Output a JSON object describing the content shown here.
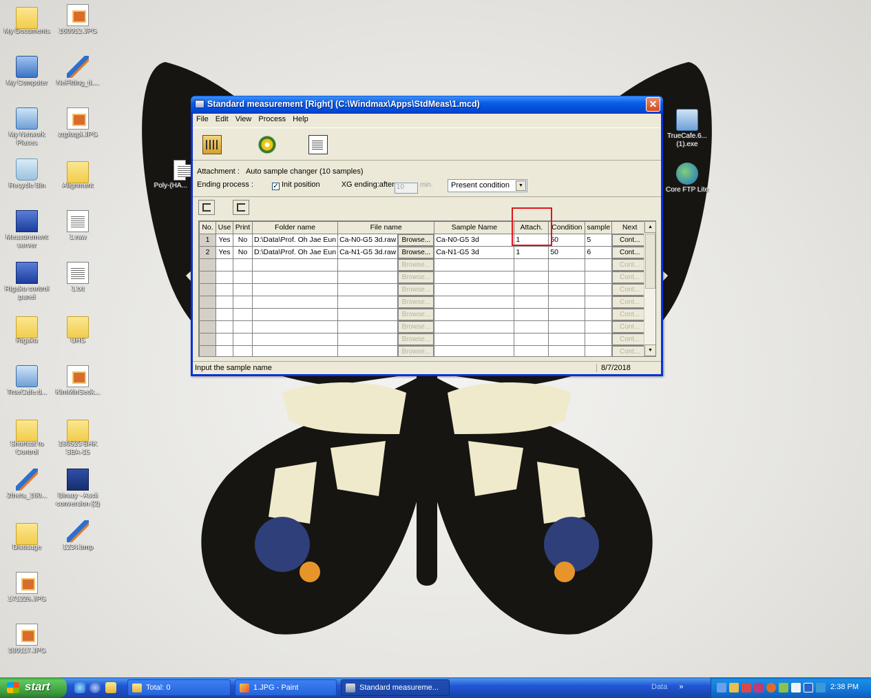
{
  "desktop": {
    "icons_left": [
      {
        "label": "My Documents",
        "icon": "folder-docs-icon"
      },
      {
        "label": "My Computer",
        "icon": "computer-icon"
      },
      {
        "label": "My Network Places",
        "icon": "network-icon"
      },
      {
        "label": "Recycle Bin",
        "icon": "recycle-bin-icon"
      },
      {
        "label": "Measurement server",
        "icon": "server-icon"
      },
      {
        "label": "Rigaku control panel",
        "icon": "control-panel-icon"
      },
      {
        "label": "Rigaku",
        "icon": "folder-icon"
      },
      {
        "label": "TrueCafe.d...",
        "icon": "network-icon"
      },
      {
        "label": "Shortcut to Control",
        "icon": "folder-icon"
      },
      {
        "label": "2theta_160...",
        "icon": "pen-icon"
      },
      {
        "label": "Disusage",
        "icon": "folder-icon"
      },
      {
        "label": "171226.JPG",
        "icon": "image-file-icon"
      },
      {
        "label": "180117.JPG",
        "icon": "image-file-icon"
      }
    ],
    "icons_right_col": [
      {
        "label": "160912.JPG",
        "icon": "image-file-icon"
      },
      {
        "label": "NeFitting_d....",
        "icon": "pen-icon"
      },
      {
        "label": "zqpbqpl.JPG",
        "icon": "image-file-icon"
      },
      {
        "label": "Alignment",
        "icon": "folder-icon"
      },
      {
        "label": "1.raw",
        "icon": "document-icon"
      },
      {
        "label": "1.txt",
        "icon": "text-file-icon"
      },
      {
        "label": "UHS",
        "icon": "folder-icon"
      },
      {
        "label": "KimMinSeok...",
        "icon": "image-file-icon"
      },
      {
        "label": "180523 BHK SBA-15",
        "icon": "folder-icon"
      },
      {
        "label": "Binary - Ascii conversion (2)",
        "icon": "floppy-icon"
      },
      {
        "label": "1234.bmp",
        "icon": "pen-icon"
      }
    ],
    "icons_far_right": [
      {
        "label": "TrueCafe.6... (1).exe",
        "icon": "network-icon"
      },
      {
        "label": "Core FTP Lite",
        "icon": "ftp-icon"
      }
    ],
    "partial_label": "Poly-(HA..."
  },
  "window": {
    "title": "Standard measurement [Right] (C:\\Windmax\\Apps\\StdMeas\\1.mcd)",
    "menu": [
      "File",
      "Edit",
      "View",
      "Process",
      "Help"
    ],
    "toolbar_icons": [
      "properties-icon",
      "gear-icon",
      "form-icon"
    ],
    "attachment_label": "Attachment :",
    "attachment_value": "Auto sample changer (10 samples)",
    "ending_label": "Ending process :",
    "init_position_label": "Init position",
    "init_position_checked": true,
    "xg_label": "XG ending:after",
    "xg_value": "10",
    "xg_unit": "min.",
    "condition_select": "Present condition",
    "grid": {
      "columns": [
        "No.",
        "Use",
        "Print",
        "Folder name",
        "File name",
        "",
        "Sample Name",
        "Attach.",
        "Condition",
        "sample",
        "Next"
      ],
      "rows": [
        {
          "no": "1",
          "use": "Yes",
          "print": "No",
          "folder": "D:\\Data\\Prof. Oh Jae Eun",
          "file": "Ca-N0-G5 3d.raw",
          "browse": "Browse...",
          "sample_name": "Ca-N0-G5 3d",
          "attach": "1",
          "condition": "50",
          "sample": "5",
          "next": "Cont..."
        },
        {
          "no": "2",
          "use": "Yes",
          "print": "No",
          "folder": "D:\\Data\\Prof. Oh Jae Eun",
          "file": "Ca-N1-G5 3d.raw",
          "browse": "Browse...",
          "sample_name": "Ca-N1-G5 3d",
          "attach": "1",
          "condition": "50",
          "sample": "6",
          "next": "Cont..."
        }
      ],
      "empty_browse": "Browse...",
      "empty_next": "Cont..."
    },
    "status_message": "Input the sample name",
    "status_date": "8/7/2018"
  },
  "taskbar": {
    "start_label": "start",
    "tasks": [
      {
        "label": "Total: 0",
        "icon": "folder-icon"
      },
      {
        "label": "1.JPG - Paint",
        "icon": "paint-icon"
      },
      {
        "label": "Standard measureme...",
        "icon": "window-icon"
      }
    ],
    "data_label": "Data",
    "chevron": "»",
    "clock": "2:38 PM"
  },
  "colors": {
    "highlight": "#e0141b",
    "titlebar": "#0a5ee6"
  }
}
